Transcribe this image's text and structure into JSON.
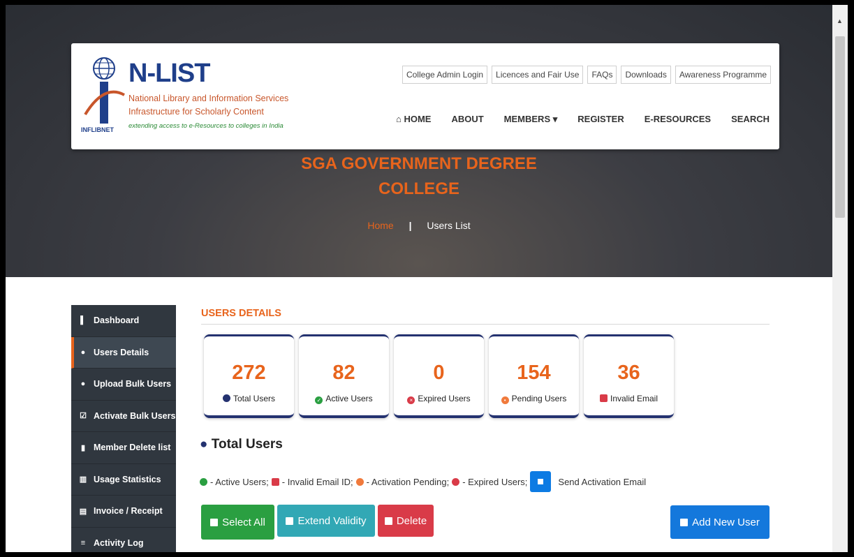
{
  "header": {
    "logo": {
      "title": "N-LIST",
      "subtitle_1": "National Library and Information Services",
      "subtitle_2": "Infrastructure for Scholarly Content",
      "tagline": "extending access to e-Resources to colleges in India",
      "inflibnet": "INFLIBNET"
    },
    "top_links": [
      "College Admin Login",
      "Licences and Fair Use",
      "FAQs",
      "Downloads",
      "Awareness Programme"
    ],
    "nav": [
      {
        "label": "HOME",
        "icon": "home-icon"
      },
      {
        "label": "ABOUT"
      },
      {
        "label": "MEMBERS ▾"
      },
      {
        "label": "REGISTER"
      },
      {
        "label": "E-RESOURCES"
      },
      {
        "label": "SEARCH"
      }
    ]
  },
  "hero": {
    "college_line1": "SGA GOVERNMENT DEGREE",
    "college_line2": "COLLEGE",
    "breadcrumb_home": "Home",
    "breadcrumb_sep": "|",
    "breadcrumb_current": "Users List"
  },
  "sidebar": {
    "items": [
      {
        "label": "Dashboard",
        "icon": "dashboard-icon"
      },
      {
        "label": "Users Details",
        "icon": "user-icon",
        "active": true
      },
      {
        "label": "Upload Bulk Users",
        "icon": "users-icon"
      },
      {
        "label": "Activate Bulk Users",
        "icon": "checkbox-icon"
      },
      {
        "label": "Member Delete list",
        "icon": "trash-icon"
      },
      {
        "label": "Usage Statistics",
        "icon": "chart-icon"
      },
      {
        "label": "Invoice / Receipt",
        "icon": "print-icon"
      },
      {
        "label": "Activity Log",
        "icon": "list-icon"
      }
    ]
  },
  "main": {
    "section_title": "USERS DETAILS",
    "stats": [
      {
        "value": "272",
        "label": "Total Users",
        "icon": "users-icon",
        "color": "#243270"
      },
      {
        "value": "82",
        "label": "Active Users",
        "icon": "check-circle-icon",
        "color": "#2a9f41"
      },
      {
        "value": "0",
        "label": "Expired Users",
        "icon": "times-circle-icon",
        "color": "#d93b48"
      },
      {
        "value": "154",
        "label": "Pending Users",
        "icon": "pending-circle-icon",
        "color": "#f07a3c"
      },
      {
        "value": "36",
        "label": "Invalid Email",
        "icon": "envelope-icon",
        "color": "#d93b48"
      }
    ],
    "total_users_heading": "Total Users",
    "legend": {
      "active": "- Active Users;",
      "invalid": "- Invalid Email ID;",
      "pending": "- Activation Pending;",
      "expired": "- Expired Users;",
      "send": "Send Activation Email"
    },
    "buttons": {
      "select_all": "Select All",
      "extend_validity": "Extend Validity",
      "delete": "Delete",
      "add_new_user": "Add New User"
    }
  },
  "colors": {
    "accent_orange": "#e8641c",
    "navy": "#243270",
    "sidebar_bg": "#30373f"
  }
}
